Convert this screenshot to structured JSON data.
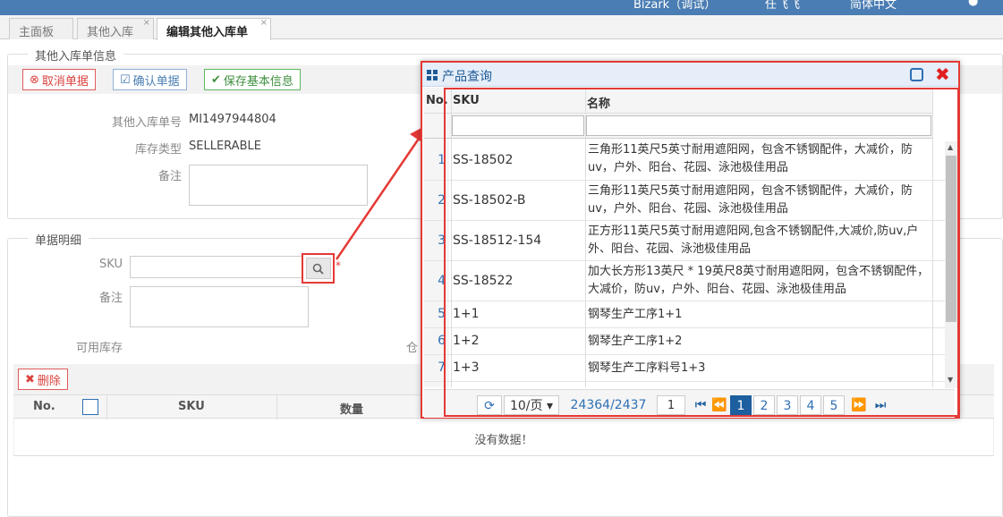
{
  "topbar": {
    "items": [
      "Bizark（调试）",
      "任飞飞",
      "简体中文"
    ]
  },
  "tabs": [
    {
      "label": "主面板"
    },
    {
      "label": "其他入库"
    },
    {
      "label": "编辑其他入库单"
    }
  ],
  "info_section": {
    "legend": "其他入库单信息",
    "buttons": {
      "cancel": "取消单据",
      "confirm": "确认单据",
      "save": "保存基本信息"
    },
    "fields": {
      "order_no_label": "其他入库单号",
      "order_no_value": "MI1497944804",
      "stock_type_label": "库存类型",
      "stock_type_value": "SELLERABLE",
      "remark_label": "备注"
    }
  },
  "detail_section": {
    "legend": "单据明细",
    "sku_label": "SKU",
    "remark_label": "备注",
    "available_label": "可用库存",
    "partial_label": "仓",
    "required_mark": "*",
    "delete_button": "删除",
    "columns": {
      "no": "No.",
      "sku": "SKU",
      "qty": "数量"
    },
    "empty_text": "没有数据！"
  },
  "dialog": {
    "title": "产品查询",
    "columns": {
      "no": "No.",
      "sku": "SKU",
      "name": "名称"
    },
    "rows": [
      {
        "no": "1",
        "sku": "SS-18502",
        "name": "三角形11英尺5英寸耐用遮阳网，包含不锈钢配件，大减价，防uv，户外、阳台、花园、泳池极佳用品"
      },
      {
        "no": "2",
        "sku": "SS-18502-B",
        "name": "三角形11英尺5英寸耐用遮阳网，包含不锈钢配件，大减价，防uv，户外、阳台、花园、泳池极佳用品"
      },
      {
        "no": "3",
        "sku": "SS-18512-154",
        "name": "正方形11英尺5英寸耐用遮阳网,包含不锈钢配件,大减价,防uv,户外、阳台、花园、泳池极佳用品"
      },
      {
        "no": "4",
        "sku": "SS-18522",
        "name": "加大长方形13英尺 * 19英尺8英寸耐用遮阳网，包含不锈钢配件，大减价，防uv，户外、阳台、花园、泳池极佳用品"
      },
      {
        "no": "5",
        "sku": "1+1",
        "name": "钢琴生产工序1+1"
      },
      {
        "no": "6",
        "sku": "1+2",
        "name": "钢琴生产工序1+2"
      },
      {
        "no": "7",
        "sku": "1+3",
        "name": "钢琴生产工序料号1+3"
      }
    ],
    "pager": {
      "page_size": "10/页",
      "total": "24364/2437",
      "page_input": "1",
      "pages": [
        "1",
        "2",
        "3",
        "4",
        "5"
      ],
      "current": "1"
    }
  }
}
